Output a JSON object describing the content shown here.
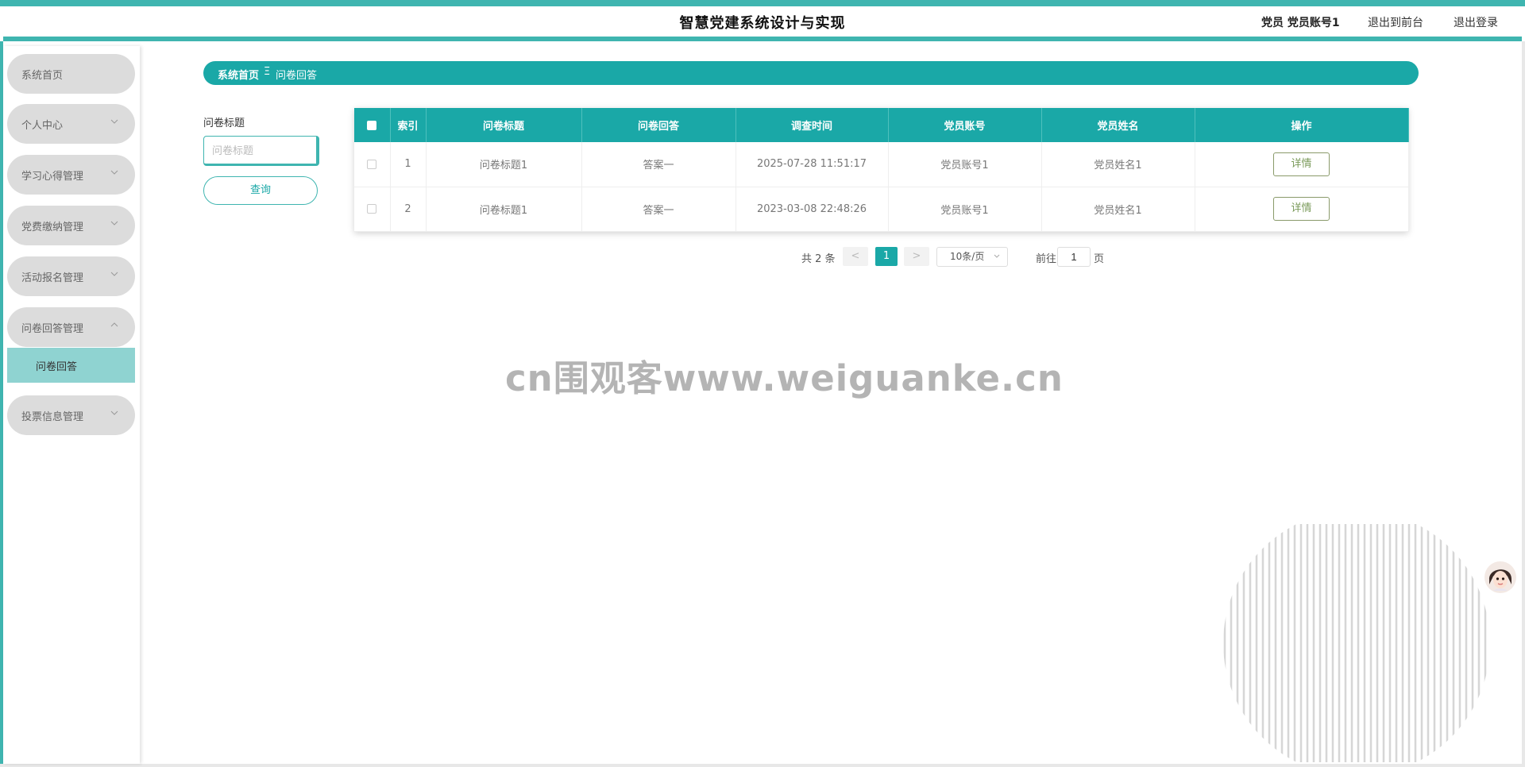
{
  "header": {
    "title": "智慧党建系统设计与实现",
    "user": "党员 党员账号1",
    "front_link": "退出到前台",
    "logout_link": "退出登录"
  },
  "sidebar": {
    "items": [
      {
        "label": "系统首页"
      },
      {
        "label": "个人中心"
      },
      {
        "label": "学习心得管理"
      },
      {
        "label": "党费缴纳管理"
      },
      {
        "label": "活动报名管理"
      },
      {
        "label": "问卷回答管理"
      },
      {
        "label": "投票信息管理"
      }
    ],
    "sub_item": "问卷回答"
  },
  "breadcrumb": {
    "home": "系统首页",
    "separator": "Ξ",
    "current": "问卷回答"
  },
  "search": {
    "label": "问卷标题",
    "placeholder": "问卷标题",
    "button": "查询"
  },
  "table": {
    "columns": [
      "索引",
      "问卷标题",
      "问卷回答",
      "调查时间",
      "党员账号",
      "党员姓名",
      "操作"
    ],
    "rows": [
      {
        "index": "1",
        "title": "问卷标题1",
        "answer": "答案一",
        "time": "2025-07-28 11:51:17",
        "account": "党员账号1",
        "name": "党员姓名1",
        "action": "详情"
      },
      {
        "index": "2",
        "title": "问卷标题1",
        "answer": "答案一",
        "time": "2023-03-08 22:48:26",
        "account": "党员账号1",
        "name": "党员姓名1",
        "action": "详情"
      }
    ]
  },
  "pagination": {
    "total": "共 2 条",
    "prev": "<",
    "current": "1",
    "next": ">",
    "page_size": "10条/页",
    "goto_label": "前往",
    "goto_value": "1",
    "goto_unit": "页"
  },
  "watermark": "cn围观客www.weiguanke.cn",
  "colors": {
    "accent": "#1aa8a7",
    "header_line": "#3fb5b0",
    "menu_bg": "#dcdcdc",
    "submenu_bg": "#8fd3d1"
  }
}
